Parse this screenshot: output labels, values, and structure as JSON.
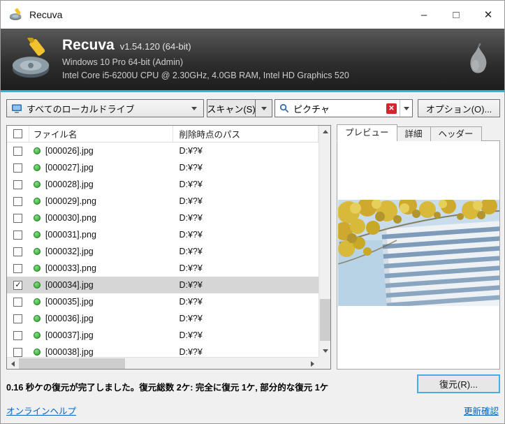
{
  "window": {
    "title": "Recuva"
  },
  "titlebar": {
    "minimize": "–",
    "maximize": "□",
    "close": "✕"
  },
  "header": {
    "app_name": "Recuva",
    "version": "v1.54.120 (64-bit)",
    "os_line": "Windows 10 Pro 64-bit (Admin)",
    "hw_line": "Intel Core i5-6200U CPU @ 2.30GHz, 4.0GB RAM, Intel HD Graphics 520"
  },
  "toolbar": {
    "drive_select_value": "すべてのローカルドライブ",
    "scan_label": "スキャン(S)",
    "search_value": "ピクチャ",
    "clear_glyph": "✕",
    "options_label": "オプション(O)..."
  },
  "list": {
    "columns": [
      "ファイル名",
      "削除時点のパス"
    ],
    "rows": [
      {
        "checked": false,
        "selected": false,
        "status": "green",
        "name": "[000026].jpg",
        "path": "D:¥?¥"
      },
      {
        "checked": false,
        "selected": false,
        "status": "green",
        "name": "[000027].jpg",
        "path": "D:¥?¥"
      },
      {
        "checked": false,
        "selected": false,
        "status": "green",
        "name": "[000028].jpg",
        "path": "D:¥?¥"
      },
      {
        "checked": false,
        "selected": false,
        "status": "green",
        "name": "[000029].png",
        "path": "D:¥?¥"
      },
      {
        "checked": false,
        "selected": false,
        "status": "green",
        "name": "[000030].png",
        "path": "D:¥?¥"
      },
      {
        "checked": false,
        "selected": false,
        "status": "green",
        "name": "[000031].png",
        "path": "D:¥?¥"
      },
      {
        "checked": false,
        "selected": false,
        "status": "green",
        "name": "[000032].jpg",
        "path": "D:¥?¥"
      },
      {
        "checked": false,
        "selected": false,
        "status": "green",
        "name": "[000033].png",
        "path": "D:¥?¥"
      },
      {
        "checked": true,
        "selected": true,
        "status": "green",
        "name": "[000034].jpg",
        "path": "D:¥?¥"
      },
      {
        "checked": false,
        "selected": false,
        "status": "green",
        "name": "[000035].jpg",
        "path": "D:¥?¥"
      },
      {
        "checked": false,
        "selected": false,
        "status": "green",
        "name": "[000036].jpg",
        "path": "D:¥?¥"
      },
      {
        "checked": false,
        "selected": false,
        "status": "green",
        "name": "[000037].jpg",
        "path": "D:¥?¥"
      },
      {
        "checked": false,
        "selected": false,
        "status": "green",
        "name": "[000038].jpg",
        "path": "D:¥?¥"
      }
    ]
  },
  "preview": {
    "tabs": [
      "プレビュー",
      "詳細",
      "ヘッダー"
    ],
    "active_tab": "プレビュー"
  },
  "statusbar": {
    "message": "0.16 秒ケの復元が完了しました。復元総数 2ケ: 完全に復元 1ケ, 部分的な復元 1ケ",
    "recover_label": "復元(R)..."
  },
  "footer": {
    "help_link": "オンラインヘルプ",
    "update_link": "更新確認"
  },
  "colors": {
    "accent_line": "#2bb3e8",
    "status_green": "#2f9e2f",
    "clear_red": "#d3262c",
    "link_blue": "#0563c1",
    "recover_focus_border": "#46aee3",
    "banner_bg_top": "#585858",
    "banner_bg_bottom": "#1d1d1d",
    "selected_row_bg": "#d6d6d6"
  }
}
